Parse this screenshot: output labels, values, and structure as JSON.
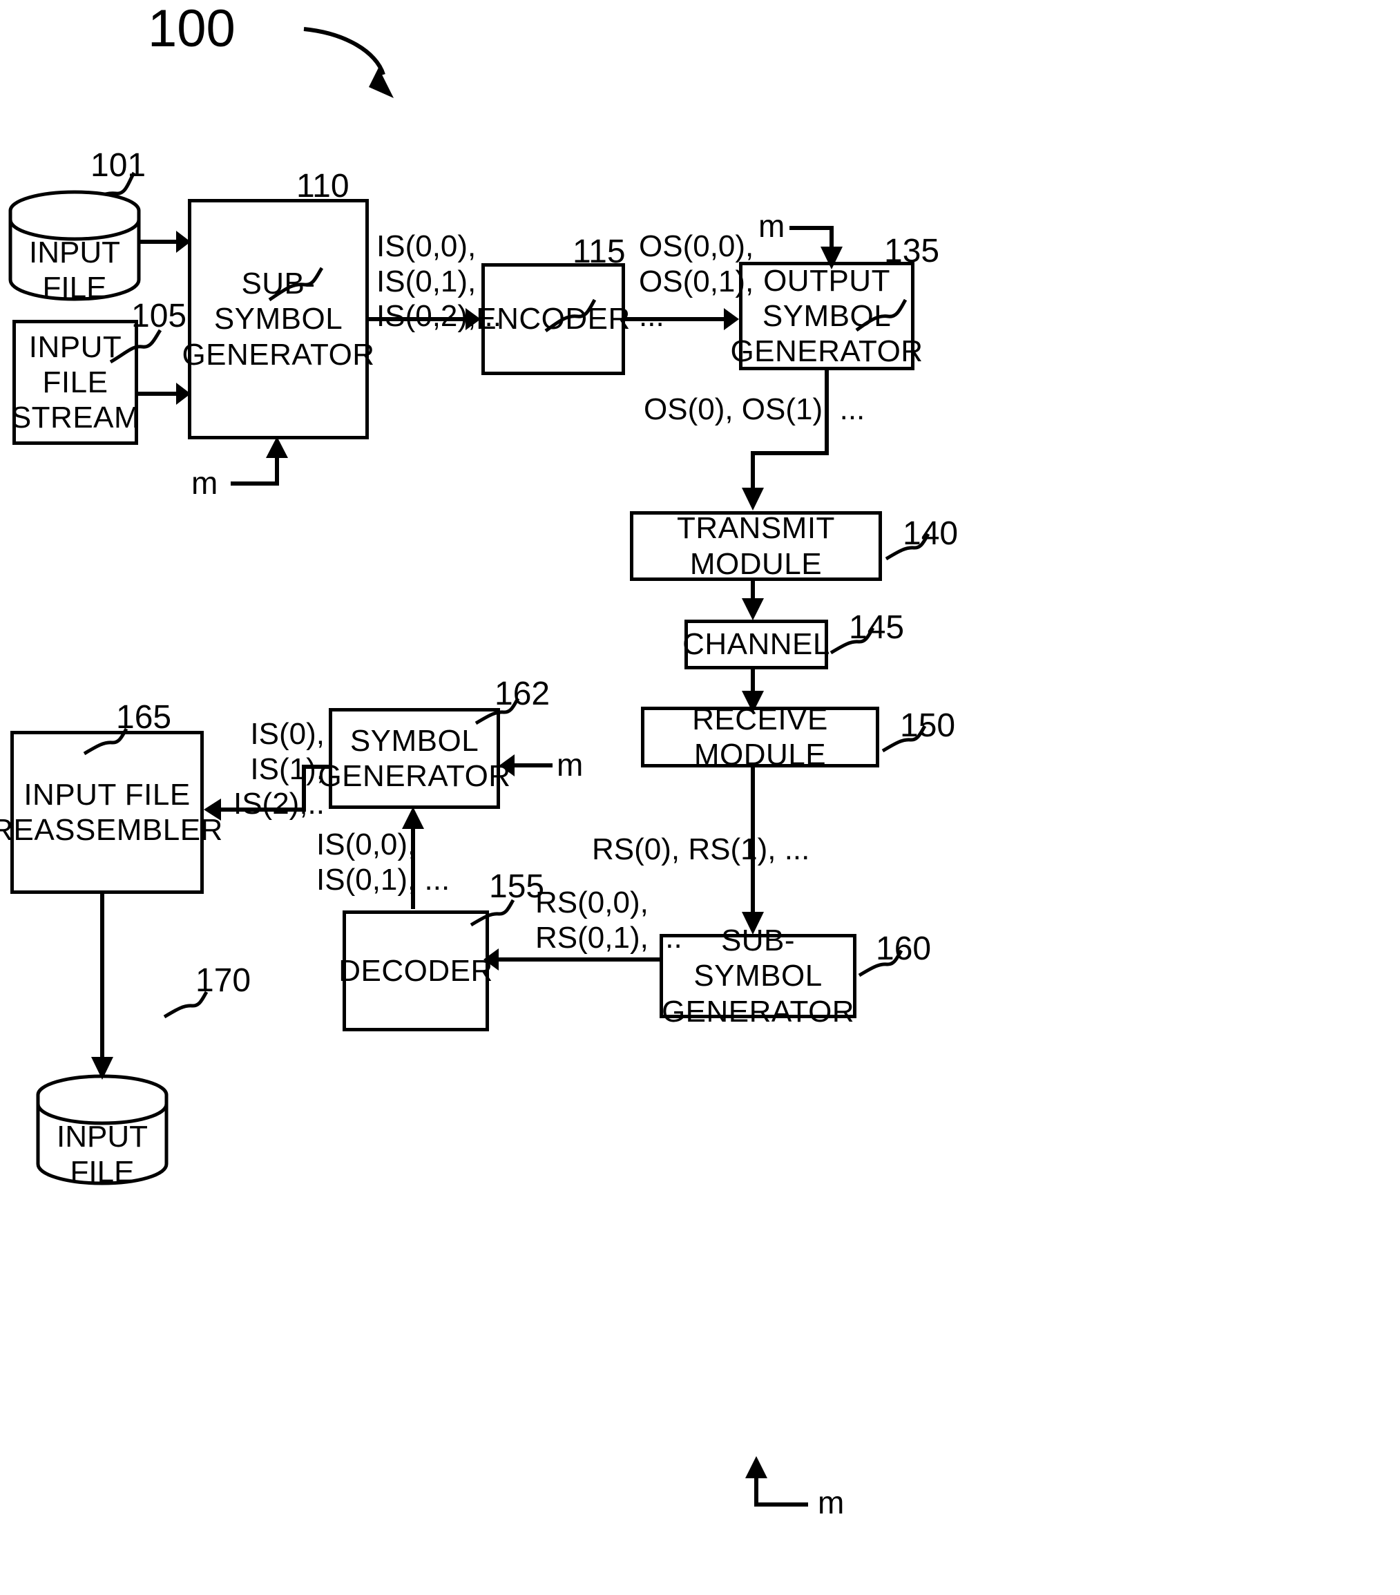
{
  "figure": {
    "number": "100"
  },
  "nodes": {
    "input_file_top": {
      "label": "INPUT\nFILE",
      "ref": "101"
    },
    "input_file_stream": {
      "label": "INPUT\nFILE\nSTREAM",
      "ref": "105"
    },
    "sub_symbol_generator_tx": {
      "label": "SUB-\nSYMBOL\nGENERATOR",
      "ref": "110"
    },
    "encoder": {
      "label": "ENCODER",
      "ref": "115"
    },
    "output_symbol_generator": {
      "label": "OUTPUT\nSYMBOL\nGENERATOR",
      "ref": "135"
    },
    "transmit_module": {
      "label": "TRANSMIT MODULE",
      "ref": "140"
    },
    "channel": {
      "label": "CHANNEL",
      "ref": "145"
    },
    "receive_module": {
      "label": "RECEIVE MODULE",
      "ref": "150"
    },
    "sub_symbol_generator_rx": {
      "label": "SUB-SYMBOL\nGENERATOR",
      "ref": "160"
    },
    "decoder": {
      "label": "DECODER",
      "ref": "155"
    },
    "symbol_generator": {
      "label": "SYMBOL\nGENERATOR",
      "ref": "162"
    },
    "input_file_reassembler": {
      "label": "INPUT FILE\nREASSEMBLER",
      "ref": "165"
    },
    "input_file_bottom": {
      "label": "INPUT\nFILE",
      "ref": "170"
    }
  },
  "flow_labels": {
    "is_sub_symbols_tx": "IS(0,0),\nIS(0,1),\nIS(0,2),...",
    "os_sub_symbols": "OS(0,0),\nOS(0,1),\n...",
    "os_symbols": "OS(0), OS(1), ...",
    "rs_symbols": "RS(0), RS(1), ...",
    "rs_sub_symbols": "RS(0,0),\nRS(0,1), ...",
    "is_sub_symbols_rx": "IS(0,0),\nIS(0,1), ...",
    "is_symbols": "IS(0), IS(1),\nIS(2),.."
  },
  "parameters": {
    "m_sub_symbol_generator_tx": "m",
    "m_output_symbol_generator": "m",
    "m_symbol_generator": "m",
    "m_sub_symbol_generator_rx": "m"
  },
  "colors": {
    "ink": "#000000",
    "paper": "#ffffff"
  }
}
